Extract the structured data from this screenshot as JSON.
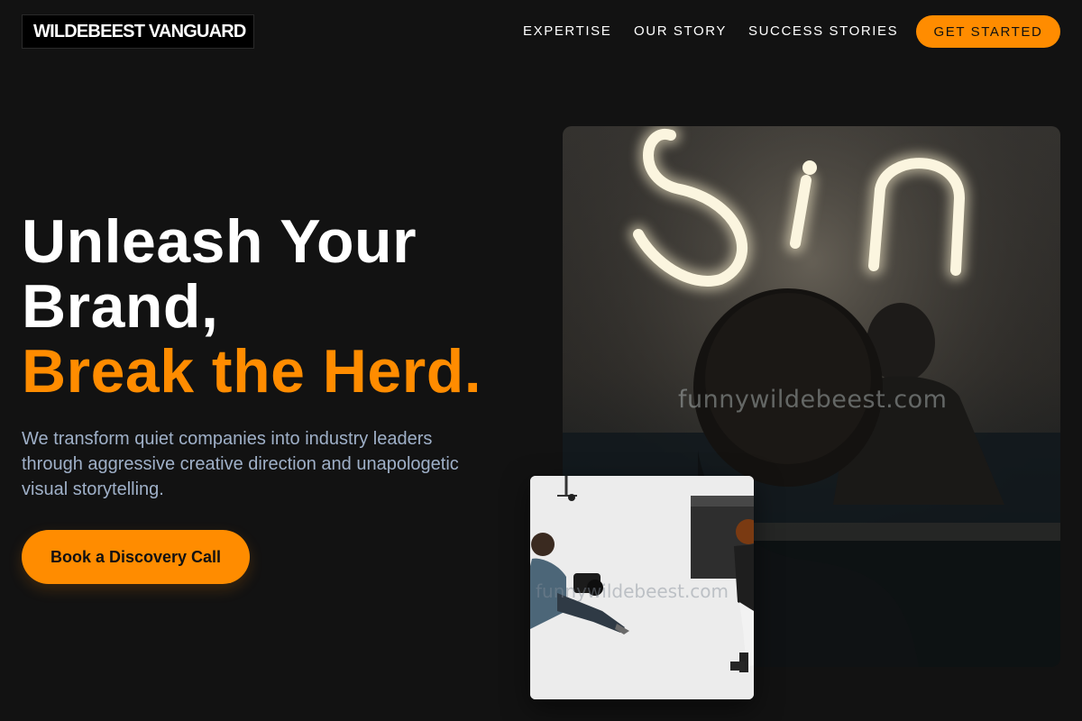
{
  "brand": {
    "name": "WILDEBEEST VANGUARD",
    "accent_color": "#ff8c00",
    "background_color": "#121212"
  },
  "nav": {
    "items": [
      {
        "label": "EXPERTISE"
      },
      {
        "label": "OUR STORY"
      },
      {
        "label": "SUCCESS STORIES"
      }
    ],
    "cta_label": "GET STARTED"
  },
  "hero": {
    "headline_line1": "Unleash Your",
    "headline_line2": "Brand,",
    "headline_accent": "Break the Herd.",
    "subtext": "We transform quiet companies into industry leaders through aggressive creative direction and unapologetic visual storytelling.",
    "cta_label": "Book a Discovery Call"
  },
  "images": {
    "main_watermark": "funnywildebeest.com",
    "secondary_watermark": "funnywildebeest.com"
  }
}
